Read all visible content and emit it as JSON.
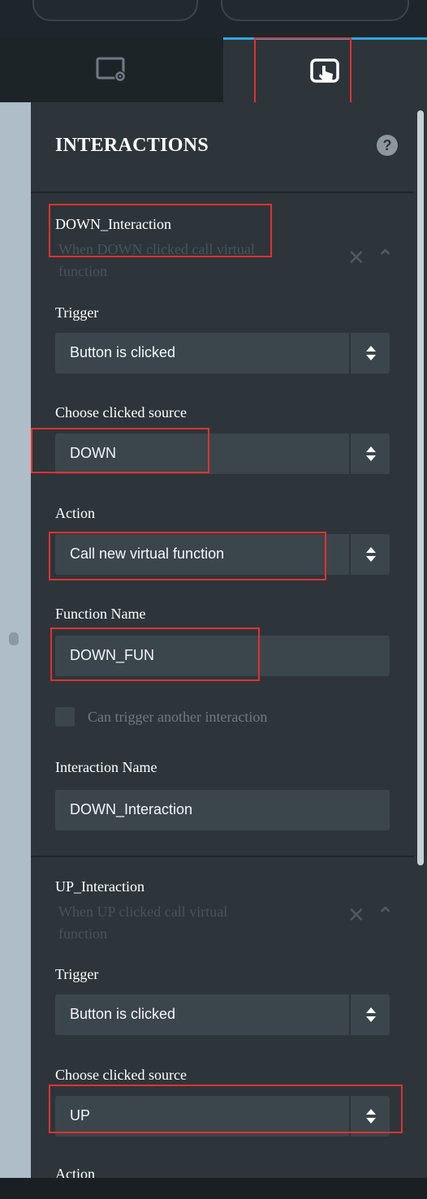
{
  "panel": {
    "title": "INTERACTIONS",
    "help_glyph": "?"
  },
  "tabs": [
    {
      "name": "properties",
      "icon": "screen-settings-icon",
      "active": false
    },
    {
      "name": "interactions",
      "icon": "touch-screen-icon",
      "active": true
    }
  ],
  "interactions": [
    {
      "title": "DOWN_Interaction",
      "description": "When DOWN clicked call virtual function",
      "trigger_label": "Trigger",
      "trigger_value": "Button is clicked",
      "source_label": "Choose clicked source",
      "source_value": "DOWN",
      "action_label": "Action",
      "action_value": "Call new virtual function",
      "function_label": "Function Name",
      "function_value": "DOWN_FUN",
      "chain_label": "Can trigger another interaction",
      "name_label": "Interaction Name",
      "name_value": "DOWN_Interaction"
    },
    {
      "title": "UP_Interaction",
      "description": "When UP clicked call virtual function",
      "trigger_label": "Trigger",
      "trigger_value": "Button is clicked",
      "source_label": "Choose clicked source",
      "source_value": "UP",
      "action_label": "Action"
    }
  ],
  "colors": {
    "accent": "#2ea7e0",
    "highlight": "#e0322d",
    "panel_bg": "#2d353b",
    "field_bg": "#3b454c"
  }
}
